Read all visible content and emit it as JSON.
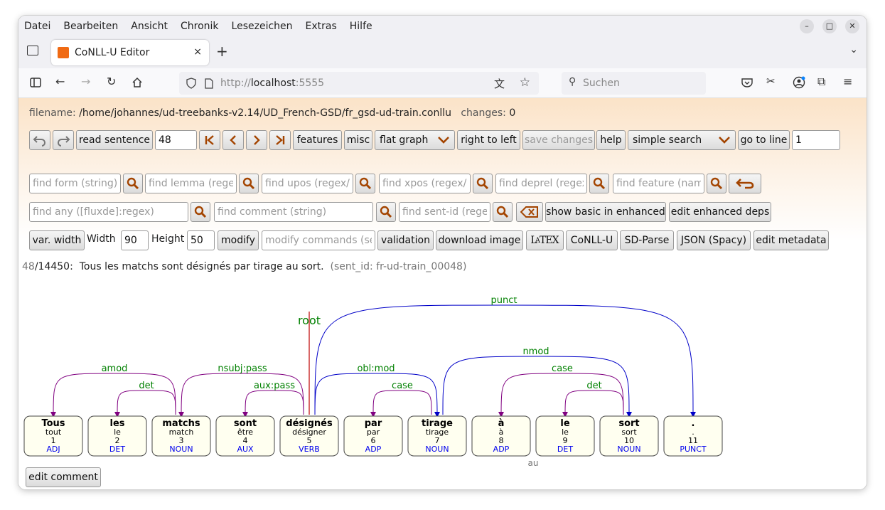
{
  "menu": [
    "Datei",
    "Bearbeiten",
    "Ansicht",
    "Chronik",
    "Lesezeichen",
    "Extras",
    "Hilfe"
  ],
  "tab": {
    "title": "CoNLL-U Editor",
    "close": "×",
    "new": "+"
  },
  "url": {
    "scheme": "http://",
    "host": "localhost",
    "port": ":5555"
  },
  "search_placeholder": "Suchen",
  "file": {
    "label": "filename:",
    "path": "/home/johannes/ud-treebanks-v2.14/UD_French-GSD/fr_gsd-ud-train.conllu",
    "changes_label": "changes:",
    "changes": "0"
  },
  "row1": {
    "read_sentence": "read sentence",
    "sentence_no": "48",
    "features": "features",
    "misc": "misc",
    "graph_mode": "flat graph",
    "rtl": "right to left",
    "save": "save changes",
    "help": "help",
    "search_mode": "simple search",
    "goto": "go to line",
    "goto_no": "1"
  },
  "row2": {
    "form": "find form (string)",
    "lemma": "find lemma (regex)",
    "upos": "find upos (regex/...)",
    "xpos": "find xpos (regex/...)",
    "deprel": "find deprel (regex)",
    "feature": "find feature (name)"
  },
  "row3": {
    "any": "find any ([fluxde]:regex)",
    "comment": "find comment (string)",
    "sentid": "find sent-id (regex)",
    "basic": "show basic in enhanced",
    "edit_enh": "edit enhanced deps"
  },
  "row4": {
    "varwidth": "var. width",
    "width_label": "Width",
    "width": "90",
    "height_label": "Height",
    "height": "50",
    "modify": "modify",
    "modify_ph": "modify commands (see help)",
    "validation": "validation",
    "download": "download image",
    "latex": "LATEX",
    "conllu": "CoNLL-U",
    "sdparse": "SD-Parse",
    "json": "JSON (Spacy)",
    "edit_meta": "edit metadata"
  },
  "sentence": {
    "pos": "48",
    "total": "/14450",
    "text": "Tous les matchs sont désignés par tirage au sort.",
    "sent_id": "(sent_id: fr-ud-train_00048)"
  },
  "tokens": [
    {
      "form": "Tous",
      "lemma": "tout",
      "id": "1",
      "upos": "ADJ"
    },
    {
      "form": "les",
      "lemma": "le",
      "id": "2",
      "upos": "DET"
    },
    {
      "form": "matchs",
      "lemma": "match",
      "id": "3",
      "upos": "NOUN"
    },
    {
      "form": "sont",
      "lemma": "être",
      "id": "4",
      "upos": "AUX"
    },
    {
      "form": "désignés",
      "lemma": "désigner",
      "id": "5",
      "upos": "VERB"
    },
    {
      "form": "par",
      "lemma": "par",
      "id": "6",
      "upos": "ADP"
    },
    {
      "form": "tirage",
      "lemma": "tirage",
      "id": "7",
      "upos": "NOUN"
    },
    {
      "form": "à",
      "lemma": "à",
      "id": "8",
      "upos": "ADP"
    },
    {
      "form": "le",
      "lemma": "le",
      "id": "9",
      "upos": "DET"
    },
    {
      "form": "sort",
      "lemma": "sort",
      "id": "10",
      "upos": "NOUN"
    },
    {
      "form": ".",
      "lemma": ".",
      "id": "11",
      "upos": "PUNCT"
    }
  ],
  "relations": [
    {
      "head": 3,
      "dep": 1,
      "label": "amod",
      "type": "purple"
    },
    {
      "head": 3,
      "dep": 2,
      "label": "det",
      "type": "purple"
    },
    {
      "head": 5,
      "dep": 3,
      "label": "nsubj:pass",
      "type": "purple"
    },
    {
      "head": 5,
      "dep": 4,
      "label": "aux:pass",
      "type": "purple"
    },
    {
      "head": 7,
      "dep": 6,
      "label": "case",
      "type": "purple"
    },
    {
      "head": 5,
      "dep": 7,
      "label": "obl:mod",
      "type": "blue"
    },
    {
      "head": 10,
      "dep": 8,
      "label": "case",
      "type": "purple"
    },
    {
      "head": 10,
      "dep": 9,
      "label": "det",
      "type": "purple"
    },
    {
      "head": 7,
      "dep": 10,
      "label": "nmod",
      "type": "blue"
    },
    {
      "head": 5,
      "dep": 11,
      "label": "punct",
      "type": "blue"
    }
  ],
  "root_label": "root",
  "mwt": {
    "form": "au",
    "from": 8,
    "to": 9
  },
  "edit_comment": "edit comment",
  "colors": {
    "purple": "#800080",
    "blue": "#0000c8",
    "root": "#cc3333",
    "label": "#008000",
    "upos": "#0000ee"
  }
}
